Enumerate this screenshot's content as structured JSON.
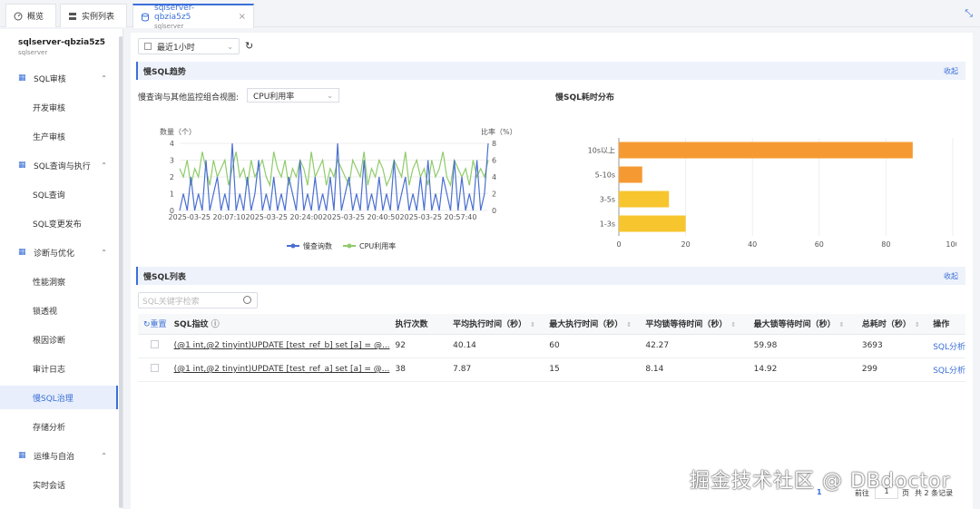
{
  "tabs": [
    {
      "label": "概览",
      "icon": "dashboard-icon"
    },
    {
      "label": "实例列表",
      "icon": "server-list-icon"
    },
    {
      "label": "sqlserver-qbzia5z5",
      "sub": "sqlserver",
      "icon": "database-icon"
    }
  ],
  "sidebar": {
    "title": "sqlserver-qbzia5z5",
    "subtitle": "sqlserver",
    "groups": [
      {
        "label": "SQL审核",
        "items": [
          "开发审核",
          "生产审核"
        ]
      },
      {
        "label": "SQL查询与执行",
        "items": [
          "SQL查询",
          "SQL变更发布"
        ]
      },
      {
        "label": "诊断与优化",
        "items": [
          "性能洞察",
          "锁透视",
          "根因诊断",
          "审计日志",
          "慢SQL治理",
          "存储分析"
        ]
      },
      {
        "label": "运维与自治",
        "items": [
          "实时会话"
        ]
      }
    ],
    "active_item": "慢SQL治理"
  },
  "toolbar": {
    "time_range": "最近1小时"
  },
  "trend": {
    "section_title": "慢SQL趋势",
    "collapse_label": "收起",
    "combo_label": "慢查询与其他监控组合视图:",
    "combo_value": "CPU利用率",
    "left_axis_title": "数量（个）",
    "right_axis_title": "比率（%）",
    "distribution_title": "慢SQL耗时分布"
  },
  "colors": {
    "accent": "#3a6fd8",
    "bar_orange": "#f59a32",
    "bar_yellow": "#f7c52e",
    "line_blue": "#4a6fd0",
    "line_green": "#8fcb6a"
  },
  "chart_data": [
    {
      "type": "line",
      "title": "",
      "xlabel": "",
      "ylabel": "数量（个）",
      "ylabel_right": "比率（%）",
      "x_ticks": [
        "2025-03-25 20:07:10",
        "2025-03-25 20:24:00",
        "2025-03-25 20:40:50",
        "2025-03-25 20:57:40"
      ],
      "ylim": [
        0,
        4
      ],
      "ylim_right": [
        0,
        8
      ],
      "y_ticks": [
        0,
        1,
        2,
        3,
        4
      ],
      "y_ticks_right": [
        0,
        2,
        4,
        6,
        8
      ],
      "legend_position": "bottom",
      "series": [
        {
          "name": "慢查询数",
          "axis": "left",
          "values": [
            0,
            1,
            0,
            2,
            0,
            1,
            0,
            3,
            0,
            1,
            2,
            0,
            1,
            0,
            4,
            0,
            1,
            0,
            2,
            0,
            1,
            3,
            0,
            1,
            0,
            2,
            0,
            1,
            0,
            2,
            1,
            0,
            3,
            0,
            1,
            0,
            2,
            0,
            1,
            0,
            2,
            0,
            4,
            0,
            1,
            2,
            0,
            1,
            0,
            3,
            0,
            1,
            0,
            2,
            0,
            1,
            0,
            3,
            0,
            1,
            2,
            0,
            1,
            0,
            2,
            0,
            3,
            0,
            1,
            0,
            2,
            1,
            0,
            3,
            0,
            2,
            0,
            1,
            0,
            3,
            0,
            1,
            4
          ]
        },
        {
          "name": "CPU利用率",
          "axis": "right",
          "values": [
            5,
            4,
            6,
            3,
            5,
            4,
            7,
            5,
            3,
            6,
            4,
            5,
            6,
            3,
            5,
            7,
            4,
            5,
            3,
            6,
            4,
            5,
            6,
            4,
            3,
            7,
            5,
            4,
            6,
            3,
            5,
            4,
            6,
            5,
            3,
            7,
            4,
            5,
            6,
            3,
            5,
            4,
            6,
            5,
            4,
            3,
            6,
            5,
            4,
            7,
            3,
            5,
            4,
            6,
            5,
            3,
            4,
            6,
            5,
            4,
            7,
            3,
            5,
            6,
            4,
            5,
            3,
            6,
            4,
            5,
            7,
            4,
            3,
            6,
            5,
            4,
            5,
            3,
            6,
            4,
            5,
            4,
            6
          ]
        }
      ]
    },
    {
      "type": "bar",
      "orientation": "horizontal",
      "title": "",
      "categories": [
        "10s以上",
        "5-10s",
        "3-5s",
        "1-3s"
      ],
      "values": [
        88,
        7,
        15,
        20
      ],
      "xlim": [
        0,
        100
      ],
      "x_ticks": [
        0,
        20,
        40,
        60,
        80,
        100
      ]
    }
  ],
  "list": {
    "section_title": "慢SQL列表",
    "collapse_label": "收起",
    "search_placeholder": "SQL关键字检索",
    "reset_label": "重置",
    "columns": [
      "SQL指纹",
      "执行次数",
      "平均执行时间（秒）",
      "最大执行时间（秒）",
      "平均锁等待时间（秒）",
      "最大锁等待时间（秒）",
      "总耗时（秒）",
      "操作"
    ],
    "rows": [
      {
        "sql": "(@1 int,@2 tinyint)UPDATE [test_ref_b] set [a] = @...",
        "count": "92",
        "avg_exec": "40.14",
        "max_exec": "60",
        "avg_lock": "42.27",
        "max_lock": "59.98",
        "total": "3693",
        "action": "SQL分析"
      },
      {
        "sql": "(@1 int,@2 tinyint)UPDATE [test_ref_a] set [a] = @...",
        "count": "38",
        "avg_exec": "7.87",
        "max_exec": "15",
        "avg_lock": "8.14",
        "max_lock": "14.92",
        "total": "299",
        "action": "SQL分析"
      }
    ]
  },
  "pager": {
    "current": "1",
    "goto_prefix": "前往",
    "goto_value": "1",
    "goto_suffix": "页",
    "total": "共 2 条记录"
  },
  "watermark": "掘金技术社区 @ DBdoctor"
}
